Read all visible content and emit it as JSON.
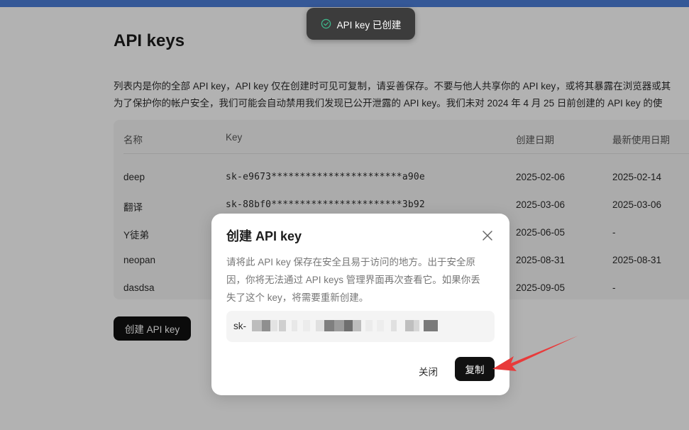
{
  "page": {
    "title": "API keys",
    "description_line1": "列表内是你的全部 API key，API key 仅在创建时可见可复制，请妥善保存。不要与他人共享你的 API key，或将其暴露在浏览器或其",
    "description_line2": "为了保护你的帐户安全，我们可能会自动禁用我们发现已公开泄露的 API key。我们未对 2024 年 4 月 25 日前创建的 API key 的使"
  },
  "table": {
    "headers": {
      "name": "名称",
      "key": "Key",
      "created": "创建日期",
      "last_used": "最新使用日期"
    },
    "rows": [
      {
        "name": "deep",
        "key": "sk-e9673***********************a90e",
        "created": "2025-02-06",
        "last_used": "2025-02-14"
      },
      {
        "name": "翻译",
        "key": "sk-88bf0***********************3b92",
        "created": "2025-03-06",
        "last_used": "2025-03-06"
      },
      {
        "name": "Y徒弟",
        "key": "",
        "created": "2025-06-05",
        "last_used": "-"
      },
      {
        "name": "neopan",
        "key": "",
        "created": "2025-08-31",
        "last_used": "2025-08-31"
      },
      {
        "name": "dasdsa",
        "key": "",
        "created": "2025-09-05",
        "last_used": "-"
      }
    ]
  },
  "create_button": "创建 API key",
  "toast": {
    "text": "API key 已创建",
    "icon": "check-circle-icon",
    "color": "#3fb68b"
  },
  "modal": {
    "title": "创建 API key",
    "text_line1": "请将此 API key 保存在安全且易于访问的地方。出于安全原",
    "text_line2": "因，你将无法通过 API keys 管理界面再次查看它。如果你丢",
    "text_line3": "失了这个 key，将需要重新创建。",
    "key_prefix": "sk-",
    "close_label": "关闭",
    "copy_label": "复制"
  },
  "annotation": {
    "type": "arrow",
    "color": "#e83b3b"
  }
}
